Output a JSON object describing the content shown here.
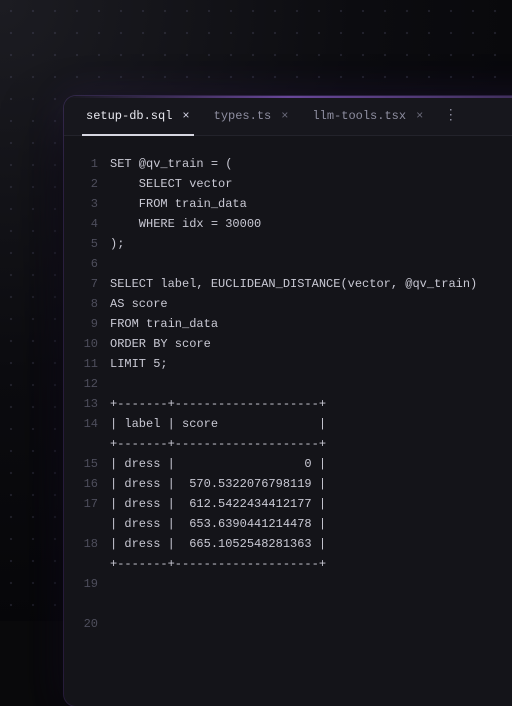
{
  "tabs": [
    {
      "label": "setup-db.sql",
      "active": true
    },
    {
      "label": "types.ts",
      "active": false
    },
    {
      "label": "llm-tools.tsx",
      "active": false
    }
  ],
  "overflow_glyph": "⋮",
  "close_glyph": "×",
  "code_lines": [
    "SET @qv_train = (",
    "    SELECT vector",
    "    FROM train_data",
    "    WHERE idx = 30000",
    ");",
    "",
    "SELECT label, EUCLIDEAN_DISTANCE(vector, @qv_train)",
    "AS score",
    "FROM train_data",
    "ORDER BY score",
    "LIMIT 5;",
    "",
    "+-------+--------------------+",
    "| label | score              |",
    "+-------+--------------------+",
    "| dress |                  0 |",
    "| dress |  570.5322076798119 |",
    "| dress |  612.5422434412177 |",
    "| dress |  653.6390441214478 |",
    "| dress |  665.1052548281363 |",
    "+-------+--------------------+",
    "",
    ""
  ],
  "line_numbers": [
    "1",
    "2",
    "3",
    "4",
    "5",
    "6",
    "7",
    "8",
    "9",
    "10",
    "11",
    "12",
    "13",
    "14",
    "",
    "15",
    "16",
    "17",
    "",
    "18",
    "",
    "19",
    "",
    "20"
  ],
  "chart_data": {
    "type": "table",
    "title": "Query result",
    "columns": [
      "label",
      "score"
    ],
    "rows": [
      [
        "dress",
        0
      ],
      [
        "dress",
        570.5322076798119
      ],
      [
        "dress",
        612.5422434412177
      ],
      [
        "dress",
        653.6390441214478
      ],
      [
        "dress",
        665.1052548281363
      ]
    ],
    "query_param_idx": 30000,
    "limit": 5
  }
}
